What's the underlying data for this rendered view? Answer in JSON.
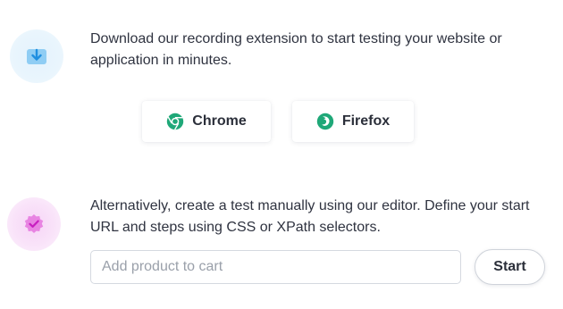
{
  "download": {
    "icon": "download-icon",
    "accent_color": "#2b9be6",
    "description": "Download our recording extension to start testing your website or application in minutes.",
    "buttons": [
      {
        "label": "Chrome",
        "icon": "chrome-icon"
      },
      {
        "label": "Firefox",
        "icon": "firefox-icon"
      }
    ],
    "browser_icon_color": "#1fa878"
  },
  "manual": {
    "icon": "check-badge-icon",
    "accent_color": "#e05ad6",
    "description": "Alternatively, create a test manually using our editor. Define your start URL and steps using CSS or XPath selectors.",
    "input": {
      "placeholder": "Add product to cart",
      "value": ""
    },
    "start_label": "Start"
  }
}
